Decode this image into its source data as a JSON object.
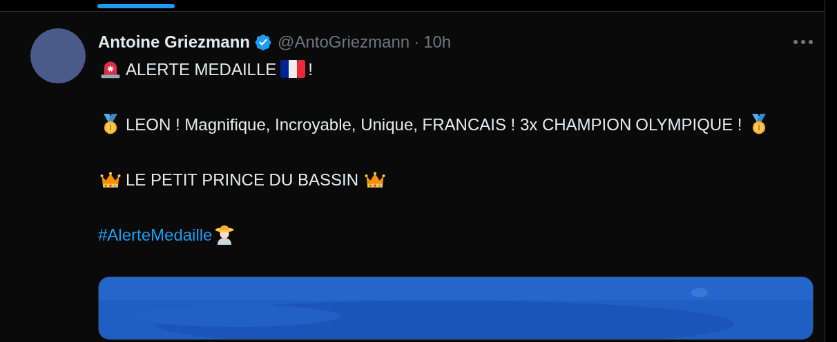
{
  "tweet": {
    "author": "Antoine Griezmann",
    "verified": true,
    "handle": "@AntoGriezmann",
    "separator": "·",
    "time": "10h",
    "paragraphs": [
      [
        {
          "kind": "siren"
        },
        {
          "kind": "text",
          "text": "ALERTE MEDAILLE"
        },
        {
          "kind": "flag"
        },
        {
          "kind": "text",
          "text": "!"
        }
      ],
      [
        {
          "kind": "medal"
        },
        {
          "kind": "text",
          "text": "LEON ! Magnifique, Incroyable, Unique, FRANCAIS ! 3x CHAMPION"
        },
        {
          "kind": "text",
          "text": "OLYMPIQUE !"
        },
        {
          "kind": "medal"
        }
      ],
      [
        {
          "kind": "crown"
        },
        {
          "kind": "text",
          "text": "LE PETIT PRINCE DU BASSIN"
        },
        {
          "kind": "crown"
        }
      ],
      [
        {
          "kind": "hashtag",
          "text": "#AlerteMedaille"
        },
        {
          "kind": "figure"
        }
      ]
    ],
    "media": {
      "kind": "picture"
    }
  }
}
